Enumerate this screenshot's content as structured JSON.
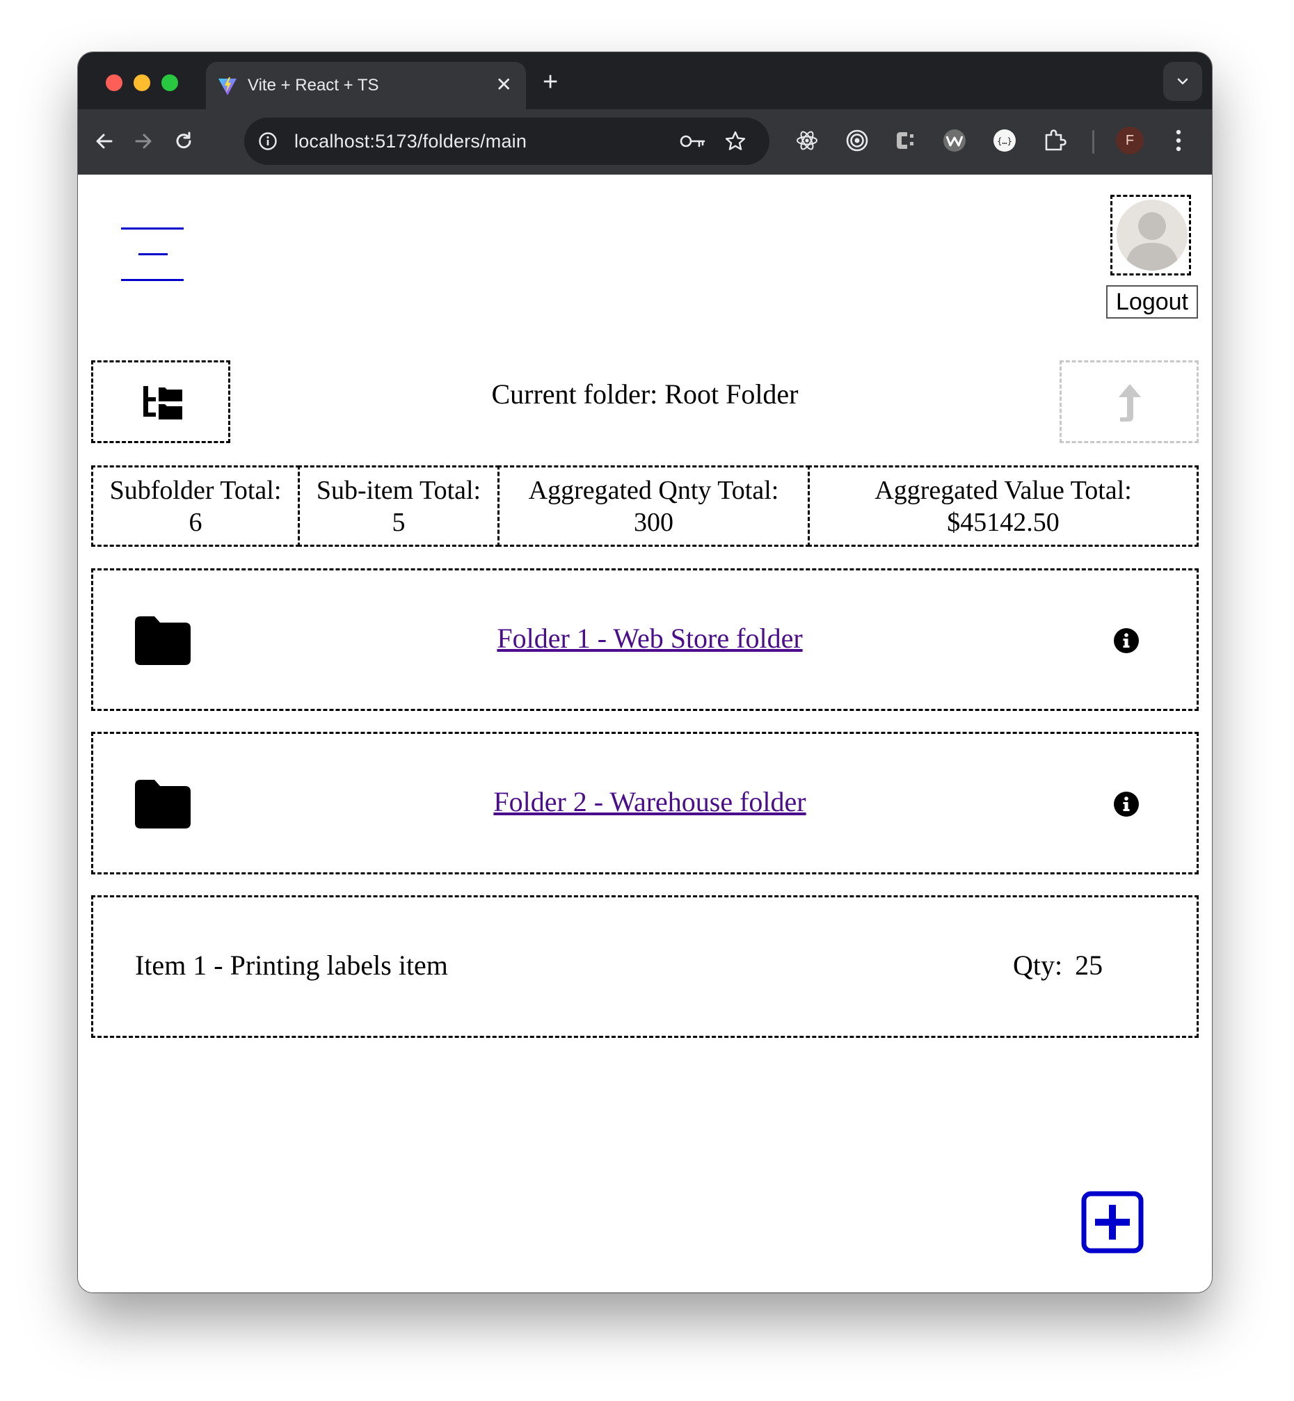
{
  "browser": {
    "tab_title": "Vite + React + TS",
    "tab_close": "✕",
    "new_tab": "+",
    "url": "localhost:5173/folders/main",
    "profile_initial": "F",
    "favicon": "vite-logo-icon",
    "extensions": [
      "react-devtools-icon",
      "target-icon",
      "c-extension-icon",
      "w-extension-icon",
      "json-extension-icon",
      "puzzle-icon"
    ]
  },
  "header": {
    "menu_icon": "hamburger-menu-icon",
    "logout_label": "Logout",
    "accent_color": "#0000cc"
  },
  "toolbar": {
    "tree_icon": "folder-tree-icon",
    "current_folder": "Current folder: Root Folder",
    "up_icon": "level-up-icon"
  },
  "stats": [
    {
      "label": "Subfolder Total:",
      "value": "6"
    },
    {
      "label": "Sub-item Total:",
      "value": "5"
    },
    {
      "label": "Aggregated Qnty Total:",
      "value": "300"
    },
    {
      "label": "Aggregated Value Total:",
      "value": "$45142.50"
    }
  ],
  "folders": [
    {
      "name": "Folder 1 - Web Store folder"
    },
    {
      "name": "Folder 2 - Warehouse folder"
    }
  ],
  "items": [
    {
      "name": "Item 1 - Printing labels item",
      "qty_label": "Qty:",
      "qty": "25"
    }
  ],
  "add_button_icon": "plus-square-icon",
  "link_color": "#4b0d8c"
}
